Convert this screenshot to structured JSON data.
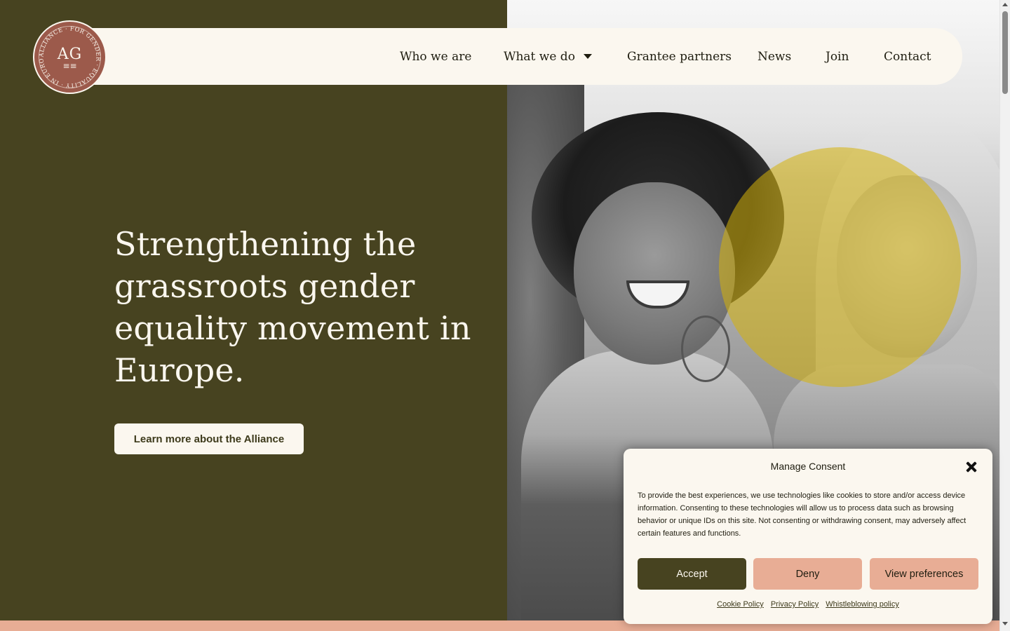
{
  "brand": {
    "logo_ring_text": "ALLIANCE · FOR GENDER · EQUALITY · IN EUROPE ·",
    "logo_letters": "AG",
    "logo_lines": "≡≡",
    "colors": {
      "olive": "#474320",
      "cream": "#fbf7ef",
      "terracotta": "#9c5a4b",
      "peach": "#e8ad95",
      "yellow": "#c9a70e"
    }
  },
  "nav": {
    "items": [
      {
        "label": "Who we are"
      },
      {
        "label": "What we do",
        "has_dropdown": true
      },
      {
        "label": "Grantee partners"
      },
      {
        "label": "News"
      },
      {
        "label": "Join"
      },
      {
        "label": "Contact"
      }
    ]
  },
  "hero": {
    "title": "Strengthening the grassroots gender equality movement in Europe.",
    "button_label": "Learn more about the Alliance"
  },
  "consent": {
    "title": "Manage Consent",
    "body": "To provide the best experiences, we use technologies like cookies to store and/or access device information. Consenting to these technologies will allow us to process data such as browsing behavior or unique IDs on this site. Not consenting or withdrawing consent, may adversely affect certain features and functions.",
    "accept_label": "Accept",
    "deny_label": "Deny",
    "preferences_label": "View preferences",
    "links": [
      "Cookie Policy",
      "Privacy Policy",
      "Whistleblowing policy"
    ]
  }
}
